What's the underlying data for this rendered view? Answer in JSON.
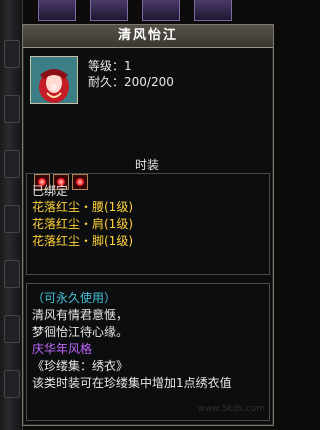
{
  "item": {
    "name": "清风怡江",
    "level": "等级：1",
    "durability": "耐久：200/200",
    "category": "时装",
    "gem_count": 3
  },
  "binding": "已绑定",
  "set_items": [
    "花落红尘・腰(1级)",
    "花落红尘・肩(1级)",
    "花落红尘・脚(1级)"
  ],
  "description": {
    "permanent": "（可永久使用）",
    "poem_1": "清风有情君意惬，",
    "poem_2": "梦徊怡江待心缘。",
    "style": "庆华年风格",
    "collection": "《珍缕集：绣衣》",
    "effect": "该类时装可在珍缕集中增加1点绣衣值"
  },
  "watermark": "www.5kds.com",
  "colors": {
    "set_text": "#ffd23a",
    "permanent_text": "#45c3d8",
    "style_text": "#c066ff"
  }
}
